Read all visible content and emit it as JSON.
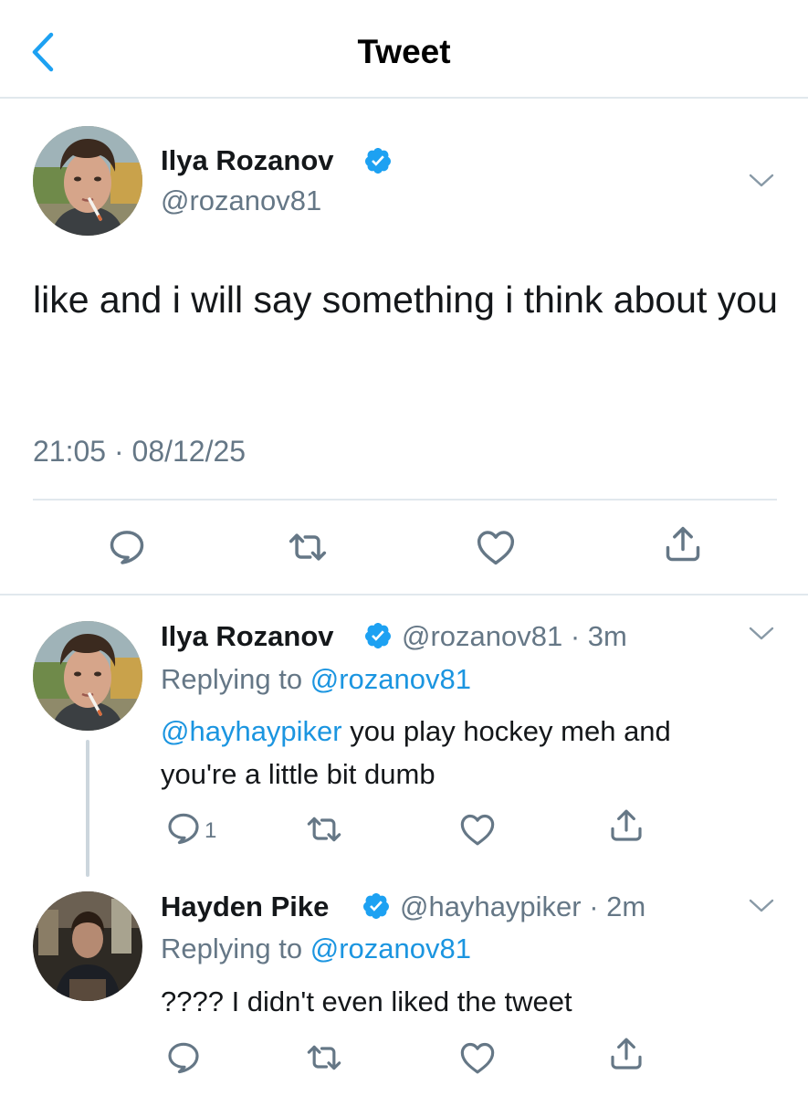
{
  "header": {
    "title": "Tweet"
  },
  "main_tweet": {
    "author": {
      "name": "Ilya Rozanov",
      "handle": "@rozanov81",
      "verified": true
    },
    "text": "like and i will say something i think about you",
    "timestamp": "21:05 · 08/12/25",
    "actions": [
      "reply-icon",
      "retweet-icon",
      "like-icon",
      "share-icon"
    ]
  },
  "replies": [
    {
      "author": {
        "name": "Ilya Rozanov",
        "handle": "@rozanov81",
        "verified": true
      },
      "time": "· 3m",
      "replying_prefix": "Replying to ",
      "replying_to": "@rozanov81",
      "mention": "@hayhaypiker",
      "text_line1": " you play hockey meh and",
      "text_line2": "you're a little bit dumb",
      "reply_count": "1"
    },
    {
      "author": {
        "name": "Hayden Pike",
        "handle": "@hayhaypiker",
        "verified": true
      },
      "time": "· 2m",
      "replying_prefix": "Replying to ",
      "replying_to": "@rozanov81",
      "text": "???? I didn't even liked the tweet"
    }
  ],
  "colors": {
    "accent": "#1da1f2",
    "link": "#1b95e0",
    "secondary": "#657786",
    "divider": "#e1e8ed"
  }
}
